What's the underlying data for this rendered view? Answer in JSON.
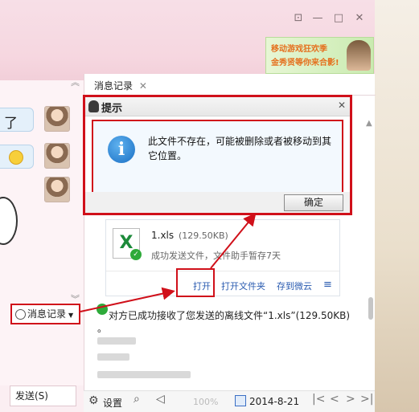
{
  "window": {
    "banner": {
      "line1": "移动游戏狂欢季",
      "line2": "金秀贤等你来合影!"
    }
  },
  "chat": {
    "partial_text_1": "了",
    "history_button_label": "消息记录",
    "send_button_label": "发送(S)"
  },
  "history_panel": {
    "tab_label": "消息记录",
    "dialog": {
      "title": "提示",
      "message": "此文件不存在，可能被删除或者被移动到其它位置。",
      "ok_label": "确定"
    },
    "file_card": {
      "name": "1.xls",
      "size": "(129.50KB)",
      "status": "成功发送文件，文件助手暂存7天",
      "actions": [
        "打开",
        "打开文件夹",
        "存到微云"
      ]
    },
    "message": "对方已成功接收了您发送的离线文件“1.xls”(129.50KB)",
    "bullet": "。"
  },
  "bottombar": {
    "settings_label": "设置",
    "date_label": "2014-8-21",
    "zoom_label": "100%"
  },
  "colors": {
    "highlight_red": "#d0101a",
    "link_blue": "#2a5bb0",
    "title_pink": "#f6d7e0"
  }
}
